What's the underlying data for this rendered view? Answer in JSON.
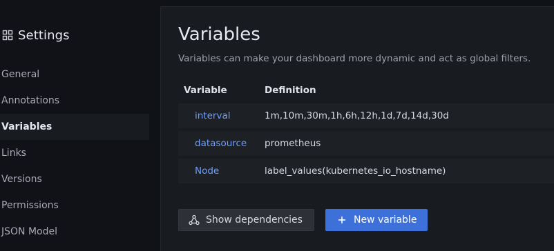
{
  "sidebar": {
    "title": "Settings",
    "title_icon": "apps-grid-icon",
    "items": [
      {
        "label": "General",
        "active": false
      },
      {
        "label": "Annotations",
        "active": false
      },
      {
        "label": "Variables",
        "active": true
      },
      {
        "label": "Links",
        "active": false
      },
      {
        "label": "Versions",
        "active": false
      },
      {
        "label": "Permissions",
        "active": false
      },
      {
        "label": "JSON Model",
        "active": false
      }
    ]
  },
  "main": {
    "title": "Variables",
    "description": "Variables can make your dashboard more dynamic and act as global filters.",
    "table": {
      "headers": {
        "variable": "Variable",
        "definition": "Definition"
      },
      "rows": [
        {
          "name": "interval",
          "definition": "1m,10m,30m,1h,6h,12h,1d,7d,14d,30d"
        },
        {
          "name": "datasource",
          "definition": "prometheus"
        },
        {
          "name": "Node",
          "definition": "label_values(kubernetes_io_hostname)"
        }
      ]
    },
    "buttons": {
      "show_dependencies": "Show dependencies",
      "show_dependencies_icon": "graph-nodes-icon",
      "new_variable": "New variable",
      "new_variable_icon": "plus-icon"
    }
  },
  "colors": {
    "background": "#111217",
    "panel": "#181b1f",
    "row": "#1d2025",
    "link": "#6e9fff",
    "primary_button": "#3d71d9",
    "secondary_button": "#2d3036"
  }
}
